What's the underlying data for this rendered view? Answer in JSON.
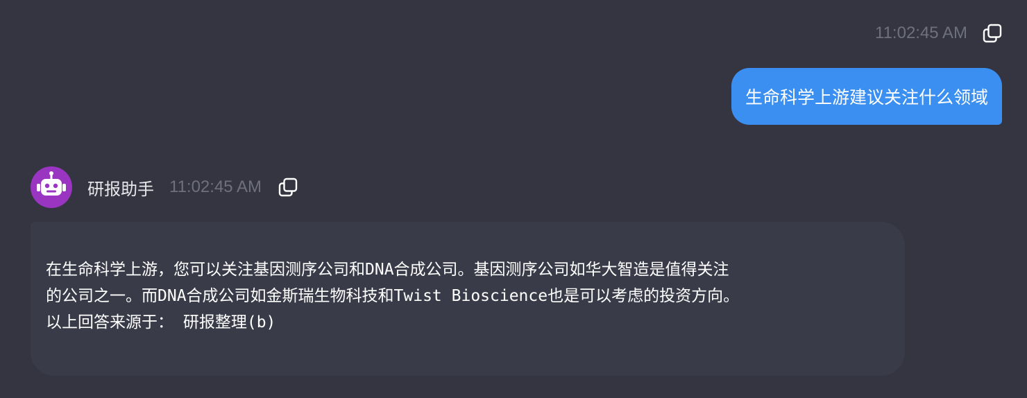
{
  "user_message": {
    "timestamp": "11:02:45 AM",
    "text": "生命科学上游建议关注什么领域"
  },
  "bot_message": {
    "name": "研报助手",
    "timestamp": "11:02:45 AM",
    "lines": [
      "在生命科学上游，您可以关注基因测序公司和DNA合成公司。基因测序公司如华大智造是值得关注",
      "的公司之一。而DNA合成公司如金斯瑞生物科技和Twist Bioscience也是可以考虑的投资方向。",
      "以上回答来源于： 研报整理(b)"
    ]
  },
  "icons": {
    "copy": "copy-icon",
    "avatar": "robot-icon"
  },
  "colors": {
    "background": "#343541",
    "user_bubble": "#3b8ff0",
    "bot_bubble": "#3a3b49",
    "avatar": "#9a35c1",
    "timestamp": "#6e707b"
  }
}
